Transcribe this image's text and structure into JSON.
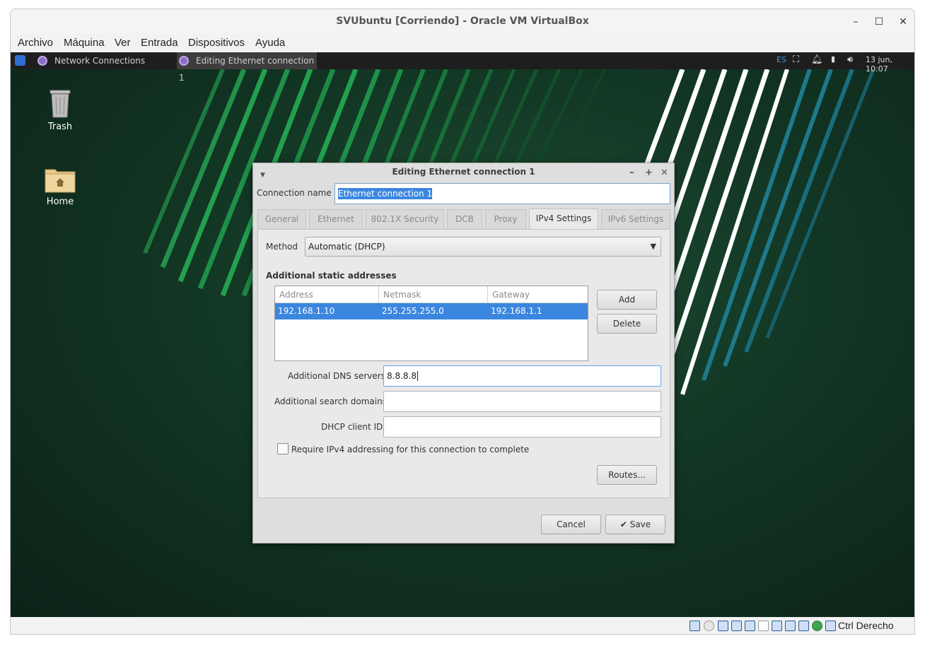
{
  "window": {
    "title": "SVUbuntu [Corriendo] - Oracle VM VirtualBox",
    "controls": [
      "–",
      "☐",
      "✕"
    ]
  },
  "menu": [
    "Archivo",
    "Máquina",
    "Ver",
    "Entrada",
    "Dispositivos",
    "Ayuda"
  ],
  "panel": {
    "tasks": [
      {
        "label": "Network Connections"
      },
      {
        "label": "Editing Ethernet connection 1"
      }
    ],
    "keyboard": "ES",
    "clock": "13 jun, 10:07"
  },
  "desktop": {
    "icons": [
      {
        "label": "Trash",
        "icon": "trash-icon"
      },
      {
        "label": "Home",
        "icon": "home-folder-icon"
      }
    ]
  },
  "dialog": {
    "title": "Editing Ethernet connection 1",
    "connection_name_label": "Connection name",
    "connection_name_value": "Ethernet connection 1",
    "tabs": [
      "General",
      "Ethernet",
      "802.1X Security",
      "DCB",
      "Proxy",
      "IPv4 Settings",
      "IPv6 Settings"
    ],
    "active_tab": "IPv4 Settings",
    "method_label": "Method",
    "method_value": "Automatic (DHCP)",
    "static_heading": "Additional static addresses",
    "table": {
      "columns": [
        "Address",
        "Netmask",
        "Gateway"
      ],
      "rows": [
        {
          "address": "192.168.1.10",
          "netmask": "255.255.255.0",
          "gateway": "192.168.1.1"
        }
      ]
    },
    "add_label": "Add",
    "delete_label": "Delete",
    "dns_label": "Additional DNS servers",
    "dns_value": "8.8.8.8",
    "search_label": "Additional search domains",
    "search_value": "",
    "dhcp_label": "DHCP client ID",
    "dhcp_value": "",
    "require_label": "Require IPv4 addressing for this connection to complete",
    "require_checked": false,
    "routes_label": "Routes...",
    "cancel_label": "Cancel",
    "save_label": "✔ Save"
  },
  "statusbar": {
    "host_key": "Ctrl Derecho"
  },
  "colors": {
    "selection": "#3b87e0",
    "desktop_green": "#143a27",
    "panel": "#1e1e1e"
  }
}
